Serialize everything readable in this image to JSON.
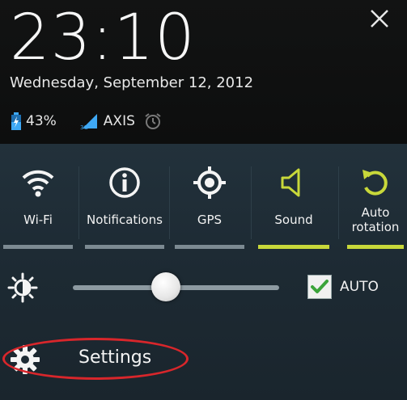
{
  "clock": {
    "time": "23:10"
  },
  "date": "Wednesday, September 12, 2012",
  "status": {
    "battery_percent": "43%",
    "network_type": "3G",
    "carrier": "AXIS"
  },
  "toggles": [
    {
      "label": "Wi-Fi",
      "icon": "wifi-icon",
      "on": false
    },
    {
      "label": "Notifications",
      "icon": "info-icon",
      "on": false
    },
    {
      "label": "GPS",
      "icon": "gps-icon",
      "on": false
    },
    {
      "label": "Sound",
      "icon": "speaker-icon",
      "on": true
    },
    {
      "label": "Auto\nrotation",
      "icon": "rotate-icon",
      "on": true
    }
  ],
  "brightness": {
    "level": 0.45,
    "auto_label": "AUTO",
    "auto_checked": true
  },
  "settings": {
    "label": "Settings"
  },
  "colors": {
    "accent_on": "#c8d83a",
    "highlight": "#d8262b",
    "panel": "#1f2d36"
  }
}
